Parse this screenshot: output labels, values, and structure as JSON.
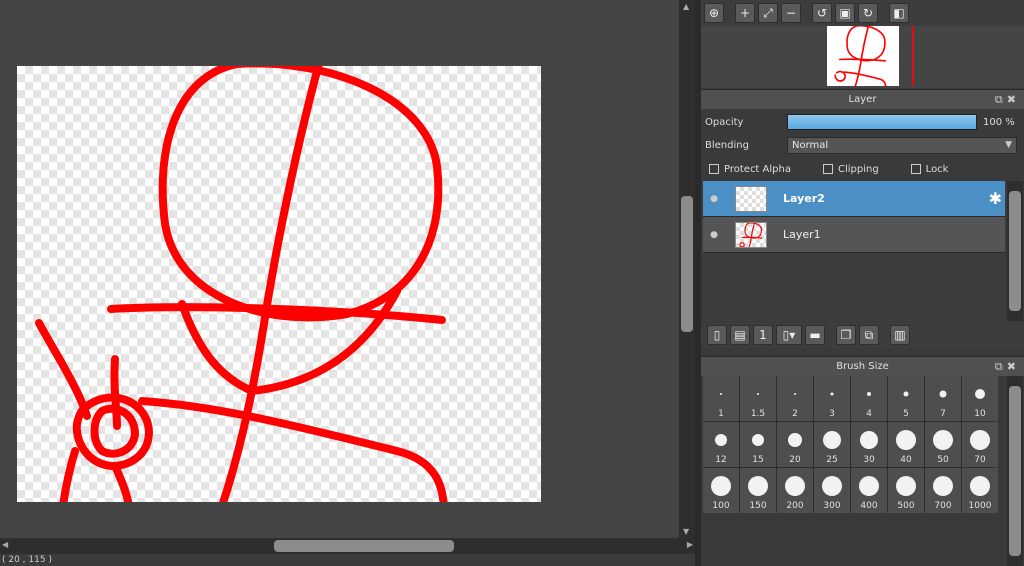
{
  "status": {
    "coords": "( 20 , 115 )"
  },
  "navigator_toolbar": {
    "buttons": [
      {
        "name": "zoom-icon",
        "glyph": "⊕"
      },
      {
        "name": "zoom-in-icon",
        "glyph": "+"
      },
      {
        "name": "fit-icon",
        "glyph": "⤢"
      },
      {
        "name": "zoom-out-icon",
        "glyph": "−"
      },
      {
        "name": "rotate-left-icon",
        "glyph": "↺"
      },
      {
        "name": "actual-size-icon",
        "glyph": "▣"
      },
      {
        "name": "rotate-right-icon",
        "glyph": "↻"
      },
      {
        "name": "flip-icon",
        "glyph": "◧"
      }
    ]
  },
  "layer_panel": {
    "title": "Layer",
    "opacity_label": "Opacity",
    "opacity_value": "100 %",
    "opacity_fraction": 1.0,
    "blending_label": "Blending",
    "blending_value": "Normal",
    "checks": [
      {
        "label": "Protect Alpha",
        "checked": false
      },
      {
        "label": "Clipping",
        "checked": false
      },
      {
        "label": "Lock",
        "checked": false
      }
    ],
    "layers": [
      {
        "name": "Layer2",
        "selected": true
      },
      {
        "name": "Layer1",
        "selected": false
      }
    ],
    "toolbar": [
      {
        "name": "new-layer-icon",
        "glyph": "🗋"
      },
      {
        "name": "new-raster-layer-icon",
        "glyph": "▤"
      },
      {
        "name": "new-halftone-layer-icon",
        "glyph": "1"
      },
      {
        "name": "add-layer-menu-icon",
        "glyph": "▾"
      },
      {
        "name": "folder-icon",
        "glyph": "▬"
      },
      {
        "name": "duplicate-layer-icon",
        "glyph": "❐"
      },
      {
        "name": "merge-layer-icon",
        "glyph": "⧉"
      },
      {
        "name": "trash-icon",
        "glyph": "🗑"
      }
    ]
  },
  "brush_panel": {
    "title": "Brush Size",
    "sizes": [
      "1",
      "1.5",
      "2",
      "3",
      "4",
      "5",
      "7",
      "10",
      "12",
      "15",
      "20",
      "25",
      "30",
      "40",
      "50",
      "70",
      "100",
      "150",
      "200",
      "300",
      "400",
      "500",
      "700",
      "1000"
    ]
  },
  "colors": {
    "stroke": "#ff0000",
    "accent": "#4a90c6"
  }
}
